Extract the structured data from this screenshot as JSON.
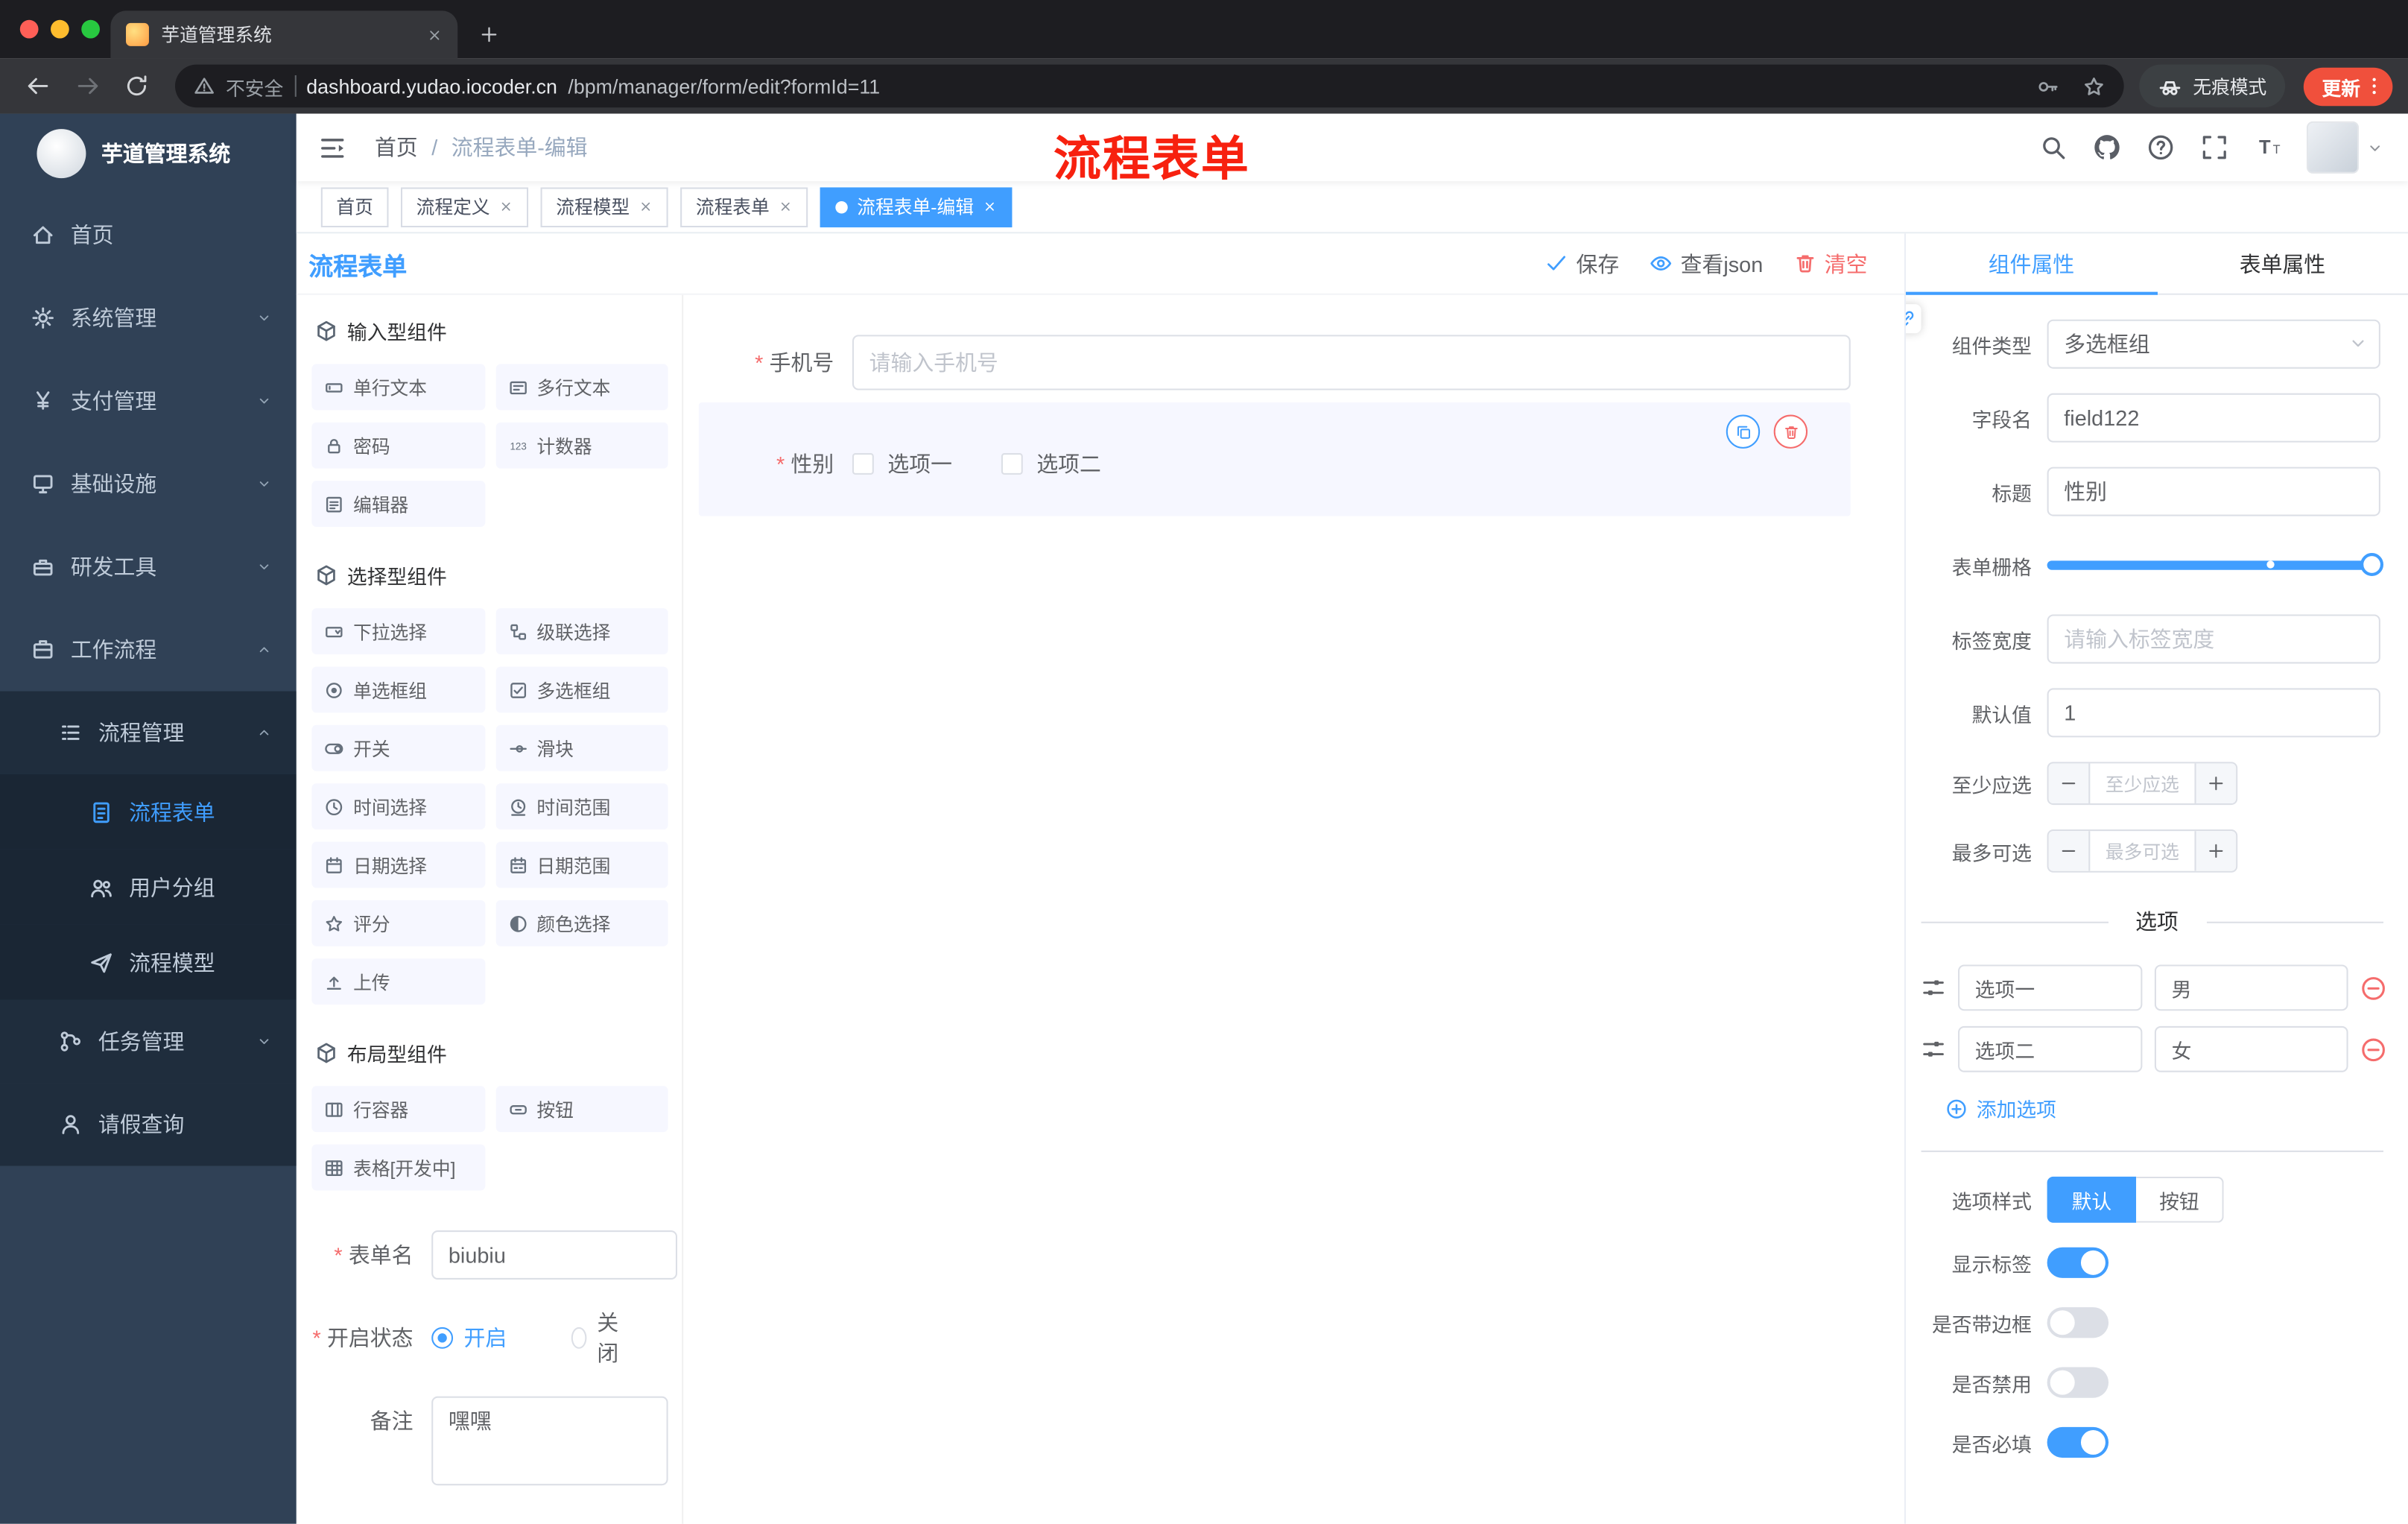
{
  "browser": {
    "tab_title": "芋道管理系统",
    "security_label": "不安全",
    "url_domain": "dashboard.yudao.iocoder.cn",
    "url_path": "/bpm/manager/form/edit?formId=11",
    "incognito_label": "无痕模式",
    "update_label": "更新"
  },
  "sidebar": {
    "logo_title": "芋道管理系统",
    "items": [
      {
        "label": "首页",
        "icon": "home"
      },
      {
        "label": "系统管理",
        "icon": "gear",
        "chevron": "caret-down"
      },
      {
        "label": "支付管理",
        "icon": "yen",
        "chevron": "caret-down"
      },
      {
        "label": "基础设施",
        "icon": "infra",
        "chevron": "caret-down"
      },
      {
        "label": "研发工具",
        "icon": "tool",
        "chevron": "caret-down"
      },
      {
        "label": "工作流程",
        "icon": "work",
        "chevron": "caret-up"
      },
      {
        "label": "流程管理",
        "icon": "flow",
        "chevron": "caret-up"
      },
      {
        "label": "流程表单",
        "icon": "doc"
      },
      {
        "label": "用户分组",
        "icon": "users"
      },
      {
        "label": "流程模型",
        "icon": "send"
      },
      {
        "label": "任务管理",
        "icon": "tasks",
        "chevron": "caret-down"
      },
      {
        "label": "请假查询",
        "icon": "person"
      }
    ]
  },
  "header": {
    "breadcrumb_home": "首页",
    "breadcrumb_sep": "/",
    "breadcrumb_current": "流程表单-编辑",
    "annotation": "流程表单",
    "annotation_color": "#f7210f"
  },
  "tags": [
    {
      "label": "首页"
    },
    {
      "label": "流程定义"
    },
    {
      "label": "流程模型"
    },
    {
      "label": "流程表单"
    },
    {
      "label": "流程表单-编辑"
    }
  ],
  "designer": {
    "panel_title": "流程表单",
    "toolbar": {
      "save": "保存",
      "view_json": "查看json",
      "clear": "清空"
    },
    "groups": [
      {
        "title": "输入型组件",
        "items": [
          {
            "label": "单行文本",
            "icon": "input"
          },
          {
            "label": "多行文本",
            "icon": "textarea"
          },
          {
            "label": "密码",
            "icon": "lock"
          },
          {
            "label": "计数器",
            "icon": "counter"
          },
          {
            "label": "编辑器",
            "icon": "editor"
          }
        ]
      },
      {
        "title": "选择型组件",
        "items": [
          {
            "label": "下拉选择",
            "icon": "select"
          },
          {
            "label": "级联选择",
            "icon": "cascade"
          },
          {
            "label": "单选框组",
            "icon": "radio"
          },
          {
            "label": "多选框组",
            "icon": "checkbox"
          },
          {
            "label": "开关",
            "icon": "switch"
          },
          {
            "label": "滑块",
            "icon": "slider"
          },
          {
            "label": "时间选择",
            "icon": "time"
          },
          {
            "label": "时间范围",
            "icon": "time-range"
          },
          {
            "label": "日期选择",
            "icon": "date"
          },
          {
            "label": "日期范围",
            "icon": "date-range"
          },
          {
            "label": "评分",
            "icon": "star"
          },
          {
            "label": "颜色选择",
            "icon": "color"
          },
          {
            "label": "上传",
            "icon": "upload"
          }
        ]
      },
      {
        "title": "布局型组件",
        "items": [
          {
            "label": "行容器",
            "icon": "row"
          },
          {
            "label": "按钮",
            "icon": "button"
          },
          {
            "label": "表格[开发中]",
            "icon": "table"
          }
        ]
      }
    ],
    "meta": {
      "form_name_label": "表单名",
      "form_name_value": "biubiu",
      "status_label": "开启状态",
      "status_on": "开启",
      "status_off": "关闭",
      "remark_label": "备注",
      "remark_value": "嘿嘿"
    },
    "canvas": {
      "phone_label": "手机号",
      "phone_placeholder": "请输入手机号",
      "gender_label": "性别",
      "gender_option1": "选项一",
      "gender_option2": "选项二"
    }
  },
  "props": {
    "tab_component": "组件属性",
    "tab_form": "表单属性",
    "component_type_label": "组件类型",
    "component_type_value": "多选框组",
    "field_name_label": "字段名",
    "field_name_value": "field122",
    "title_label": "标题",
    "title_value": "性别",
    "grid_label": "表单栅格",
    "label_width_label": "标签宽度",
    "label_width_placeholder": "请输入标签宽度",
    "default_label": "默认值",
    "default_value": "1",
    "min_label": "至少应选",
    "min_placeholder": "至少应选",
    "max_label": "最多可选",
    "max_placeholder": "最多可选",
    "options_title": "选项",
    "options": [
      {
        "label": "选项一",
        "value": "男"
      },
      {
        "label": "选项二",
        "value": "女"
      }
    ],
    "add_option": "添加选项",
    "style_label": "选项样式",
    "style_default": "默认",
    "style_button": "按钮",
    "switch_show_label": "显示标签",
    "switch_border": "是否带边框",
    "switch_disabled": "是否禁用",
    "switch_required": "是否必填"
  },
  "colors": {
    "primary": "#409eff",
    "danger": "#f56c6c"
  }
}
